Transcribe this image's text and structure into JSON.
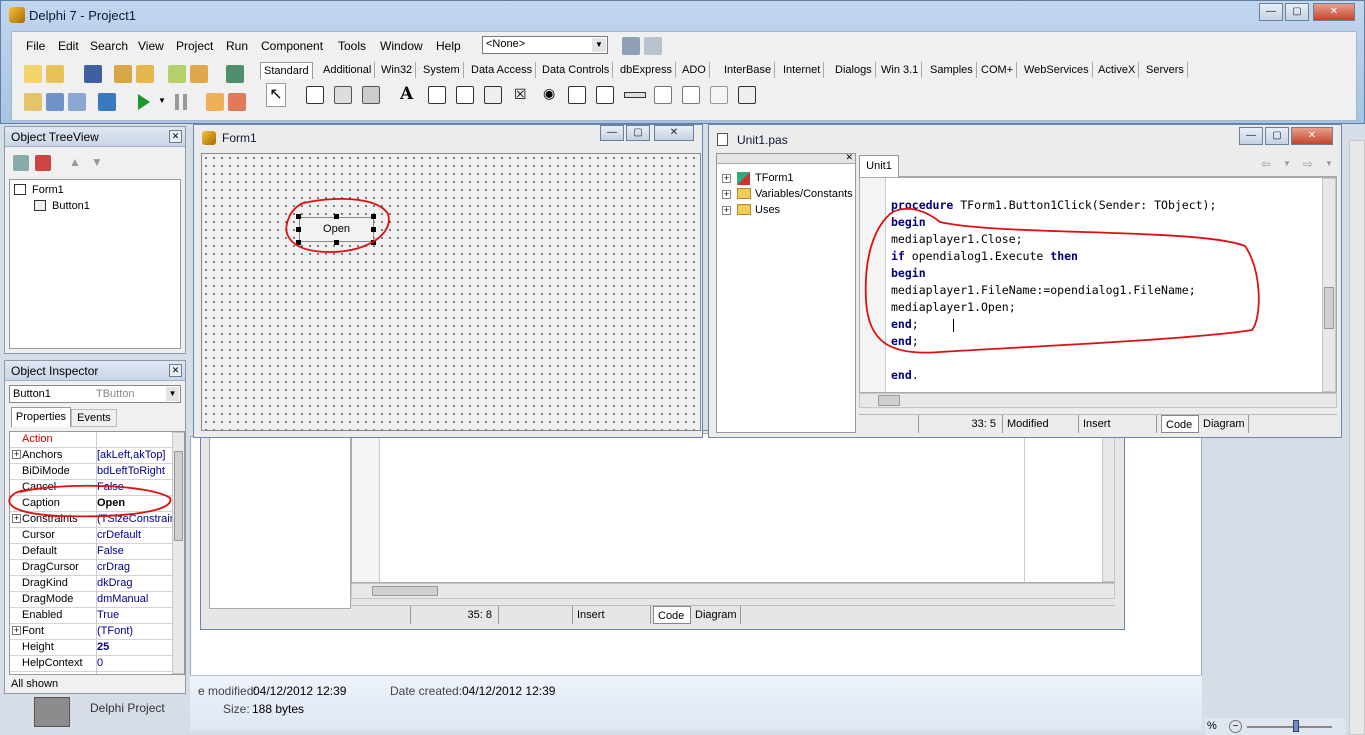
{
  "app": {
    "title": "Delphi 7 - Project1"
  },
  "menu": [
    "File",
    "Edit",
    "Search",
    "View",
    "Project",
    "Run",
    "Component",
    "Tools",
    "Window",
    "Help"
  ],
  "config_combo": "<None>",
  "palette_tabs": [
    "Standard",
    "Additional",
    "Win32",
    "System",
    "Data Access",
    "Data Controls",
    "dbExpress",
    "ADO",
    "InterBase",
    "Internet",
    "Dialogs",
    "Win 3.1",
    "Samples",
    "COM+",
    "WebServices",
    "ActiveX",
    "Servers"
  ],
  "treeview": {
    "title": "Object TreeView",
    "root": "Form1",
    "child": "Button1"
  },
  "inspector": {
    "title": "Object Inspector",
    "object": "Button1",
    "type": "TButton",
    "tabs": [
      "Properties",
      "Events"
    ],
    "rows": [
      {
        "name": "Action",
        "value": "",
        "exp": false
      },
      {
        "name": "Anchors",
        "value": "[akLeft,akTop]",
        "exp": true
      },
      {
        "name": "BiDiMode",
        "value": "bdLeftToRight",
        "exp": false
      },
      {
        "name": "Cancel",
        "value": "False",
        "exp": false
      },
      {
        "name": "Caption",
        "value": "Open",
        "exp": false
      },
      {
        "name": "Constraints",
        "value": "(TSizeConstraints)",
        "exp": true
      },
      {
        "name": "Cursor",
        "value": "crDefault",
        "exp": false
      },
      {
        "name": "Default",
        "value": "False",
        "exp": false
      },
      {
        "name": "DragCursor",
        "value": "crDrag",
        "exp": false
      },
      {
        "name": "DragKind",
        "value": "dkDrag",
        "exp": false
      },
      {
        "name": "DragMode",
        "value": "dmManual",
        "exp": false
      },
      {
        "name": "Enabled",
        "value": "True",
        "exp": false
      },
      {
        "name": "Font",
        "value": "(TFont)",
        "exp": true
      },
      {
        "name": "Height",
        "value": "25",
        "exp": false
      },
      {
        "name": "HelpContext",
        "value": "0",
        "exp": false
      }
    ],
    "status": "All shown"
  },
  "form": {
    "title": "Form1",
    "button_caption": "Open"
  },
  "unit": {
    "title": "Unit1.pas",
    "explorer": [
      "TForm1",
      "Variables/Constants",
      "Uses"
    ],
    "tab": "Unit1",
    "code": [
      {
        "t": "procedure TForm1.Button1Click(Sender: TObject);"
      },
      {
        "t": "begin"
      },
      {
        "t": "mediaplayer1.Close;"
      },
      {
        "t": "if opendialog1.Execute then"
      },
      {
        "t": "begin"
      },
      {
        "t": "mediaplayer1.FileName:=opendialog1.FileName;"
      },
      {
        "t": "mediaplayer1.Open;"
      },
      {
        "t": "end;"
      },
      {
        "t": "end;"
      },
      {
        "t": ""
      },
      {
        "t": "end."
      }
    ],
    "status": {
      "pos": "33:  5",
      "modified": "Modified",
      "mode": "Insert",
      "code_tab": "Code",
      "diagram_tab": "Diagram"
    }
  },
  "back_editor": {
    "status": {
      "pos": "35:  8",
      "mode": "Insert",
      "code_tab": "Code",
      "diagram_tab": "Diagram"
    }
  },
  "explorer_details": {
    "modified_label": "e modified:",
    "modified_value": "04/12/2012 12:39",
    "created_label": "Date created:",
    "created_value": "04/12/2012 12:39",
    "type": "Delphi Project",
    "size_label": "Size:",
    "size_value": "188 bytes",
    "zoom": "%"
  }
}
